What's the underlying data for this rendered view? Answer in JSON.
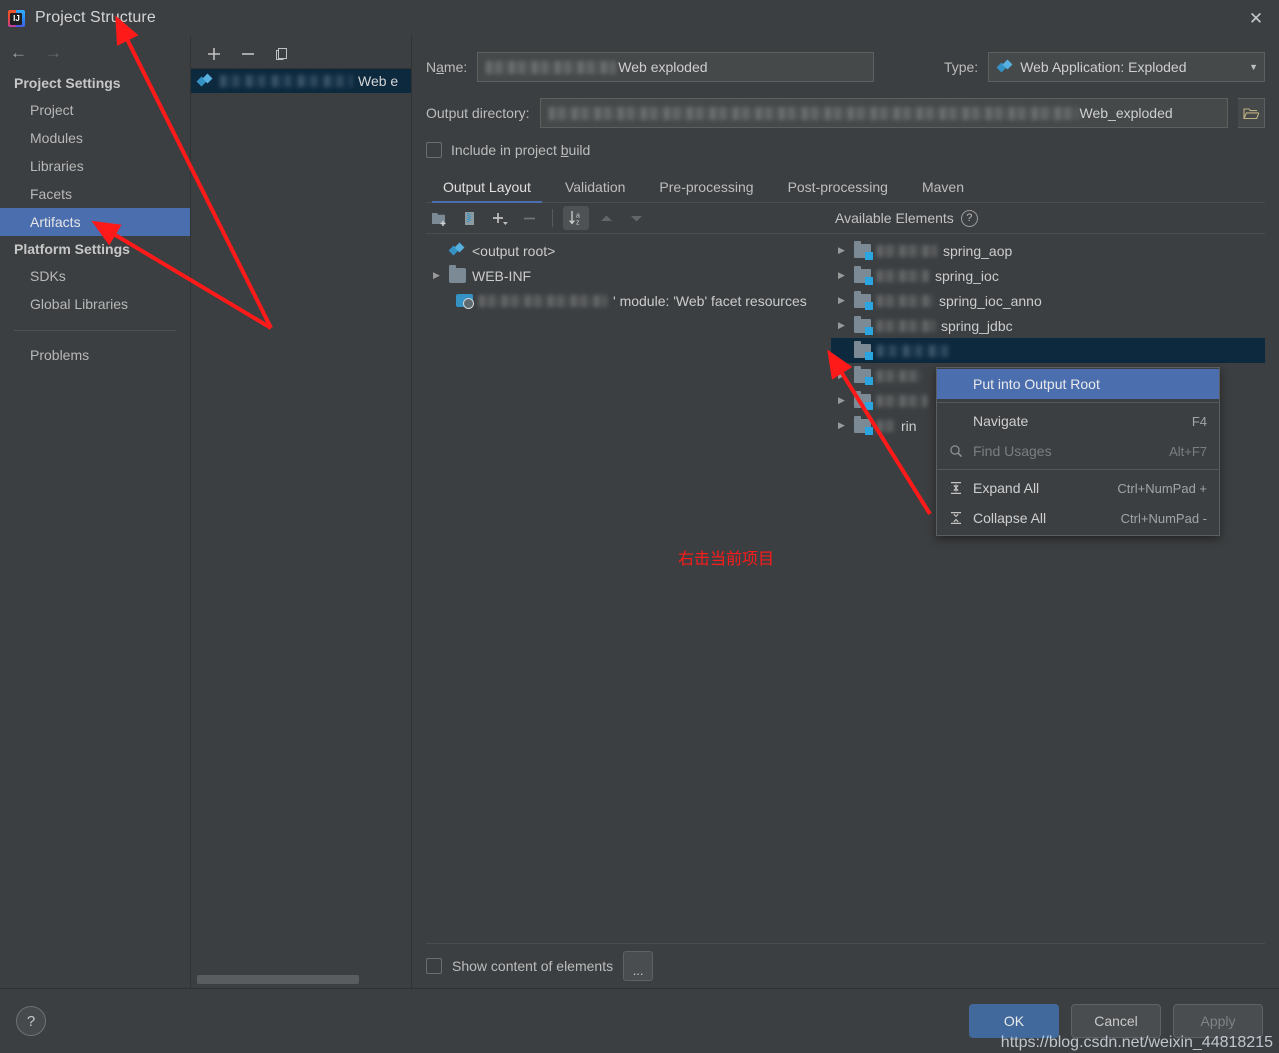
{
  "window": {
    "title": "Project Structure",
    "app_icon": "intellij-idea-icon",
    "close_label": "✕"
  },
  "sidebar": {
    "back_icon": "←",
    "forward_icon": "→",
    "groups": [
      {
        "label": "Project Settings",
        "items": [
          {
            "label": "Project",
            "selected": false
          },
          {
            "label": "Modules",
            "selected": false
          },
          {
            "label": "Libraries",
            "selected": false
          },
          {
            "label": "Facets",
            "selected": false
          },
          {
            "label": "Artifacts",
            "selected": true
          }
        ]
      },
      {
        "label": "Platform Settings",
        "items": [
          {
            "label": "SDKs",
            "selected": false
          },
          {
            "label": "Global Libraries",
            "selected": false
          }
        ]
      }
    ],
    "problems_label": "Problems"
  },
  "artifact_pane": {
    "toolbar": [
      {
        "name": "add-artifact-button",
        "glyph": "+"
      },
      {
        "name": "remove-artifact-button",
        "glyph": "−"
      },
      {
        "name": "copy-artifact-button",
        "glyph": "copy-icon"
      }
    ],
    "selected_artifact": {
      "icon": "artifact-icon",
      "redacted": true,
      "label": "Web e"
    }
  },
  "editor": {
    "name_label": "Name:",
    "name_value": "Web exploded",
    "name_redacted_prefix": true,
    "type_label": "Type:",
    "type_value": "Web Application: Exploded",
    "type_icon": "artifact-icon",
    "type_caret": "▼",
    "output_dir_label": "Output directory:",
    "output_dir_value": "Web_exploded",
    "output_dir_redacted_prefix": true,
    "browse_icon": "folder-open-icon",
    "include_build_label": "Include in project build",
    "include_build_checked": false,
    "tabs": [
      {
        "label": "Output Layout",
        "active": true
      },
      {
        "label": "Validation",
        "active": false
      },
      {
        "label": "Pre-processing",
        "active": false
      },
      {
        "label": "Post-processing",
        "active": false
      },
      {
        "label": "Maven",
        "active": false
      }
    ]
  },
  "output_layout": {
    "toolbar": [
      {
        "name": "create-directory-button",
        "glyph": "folder-plus-icon",
        "state": "normal"
      },
      {
        "name": "create-archive-button",
        "glyph": "archive-icon",
        "state": "normal"
      },
      {
        "name": "add-copy-button",
        "glyph": "plus-dropdown-icon",
        "state": "normal"
      },
      {
        "name": "remove-element-button",
        "glyph": "minus-icon",
        "state": "disabled"
      },
      {
        "name": "sort-button",
        "glyph": "sort-az-icon",
        "state": "active"
      },
      {
        "name": "move-up-button",
        "glyph": "arrow-up-icon",
        "state": "disabled"
      },
      {
        "name": "move-down-button",
        "glyph": "arrow-down-icon",
        "state": "disabled"
      }
    ],
    "tree": [
      {
        "label": "<output root>",
        "icon": "artifact-icon",
        "twisty": "none",
        "indent": 0
      },
      {
        "label": "WEB-INF",
        "icon": "folder-icon",
        "twisty": "collapsed",
        "indent": 0
      },
      {
        "label": "' module: 'Web' facet resources",
        "icon": "module-icon",
        "twisty": "none",
        "indent": 1,
        "redacted_prefix": true
      }
    ]
  },
  "available_elements": {
    "title": "Available Elements",
    "help_icon": "question-mark-icon",
    "items": [
      {
        "label": "spring_aop",
        "redacted_prefix": true,
        "twisty": "collapsed",
        "selected": false
      },
      {
        "label": "spring_ioc",
        "redacted_prefix": true,
        "twisty": "collapsed",
        "selected": false
      },
      {
        "label": "spring_ioc_anno",
        "redacted_prefix": true,
        "twisty": "collapsed",
        "selected": false
      },
      {
        "label": "spring_jdbc",
        "redacted_prefix": true,
        "twisty": "collapsed",
        "selected": false
      },
      {
        "label": "",
        "redacted_prefix": true,
        "twisty": "collapsed",
        "selected": true
      },
      {
        "label": "",
        "redacted_prefix": true,
        "twisty": "collapsed",
        "selected": false
      },
      {
        "label": "",
        "redacted_prefix": true,
        "twisty": "collapsed",
        "selected": false
      },
      {
        "label": "rin",
        "redacted_prefix": true,
        "twisty": "collapsed",
        "selected": false
      }
    ]
  },
  "context_menu": {
    "items": [
      {
        "label": "Put into Output Root",
        "shortcut": "",
        "icon": "",
        "highlight": true,
        "disabled": false
      },
      {
        "separator": true
      },
      {
        "label": "Navigate",
        "shortcut": "F4",
        "icon": "",
        "highlight": false,
        "disabled": false
      },
      {
        "label": "Find Usages",
        "shortcut": "Alt+F7",
        "icon": "search-icon",
        "highlight": false,
        "disabled": true
      },
      {
        "separator": true
      },
      {
        "label": "Expand All",
        "shortcut": "Ctrl+NumPad +",
        "icon": "expand-all-icon",
        "highlight": false,
        "disabled": false
      },
      {
        "label": "Collapse All",
        "shortcut": "Ctrl+NumPad -",
        "icon": "collapse-all-icon",
        "highlight": false,
        "disabled": false
      }
    ]
  },
  "bottom": {
    "show_content_label": "Show content of elements",
    "show_content_checked": false,
    "dots_label": "...",
    "help_label": "?",
    "ok_label": "OK",
    "cancel_label": "Cancel",
    "apply_label": "Apply"
  },
  "annotations": {
    "color": "#ff1a1a",
    "note_text": "右击当前项目",
    "watermark": "https://blog.csdn.net/weixin_44818215"
  }
}
